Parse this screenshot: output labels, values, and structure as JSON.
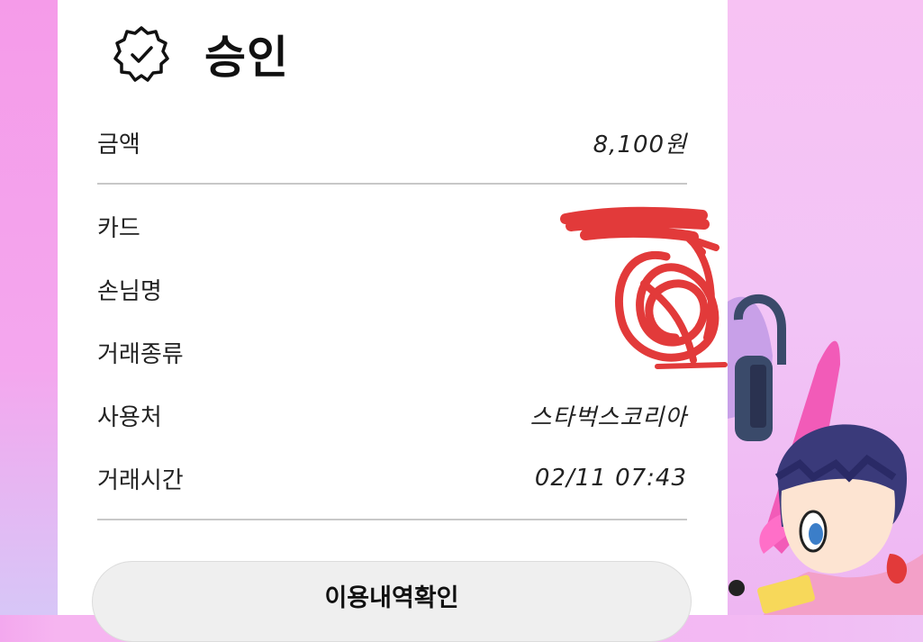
{
  "header": {
    "title": "승인",
    "icon": "check-badge-icon"
  },
  "rows": [
    {
      "label": "금액",
      "value": "8,100원"
    },
    {
      "label": "카드",
      "value": ""
    },
    {
      "label": "손님명",
      "value": ""
    },
    {
      "label": "거래종류",
      "value": ""
    },
    {
      "label": "사용처",
      "value": "스타벅스코리아"
    },
    {
      "label": "거래시간",
      "value": "02/11 07:43"
    }
  ],
  "button": {
    "label": "이용내역확인"
  },
  "colors": {
    "redaction": "#e23a3a",
    "button_bg": "#efefef",
    "background_pink": "#f4b2ef"
  }
}
